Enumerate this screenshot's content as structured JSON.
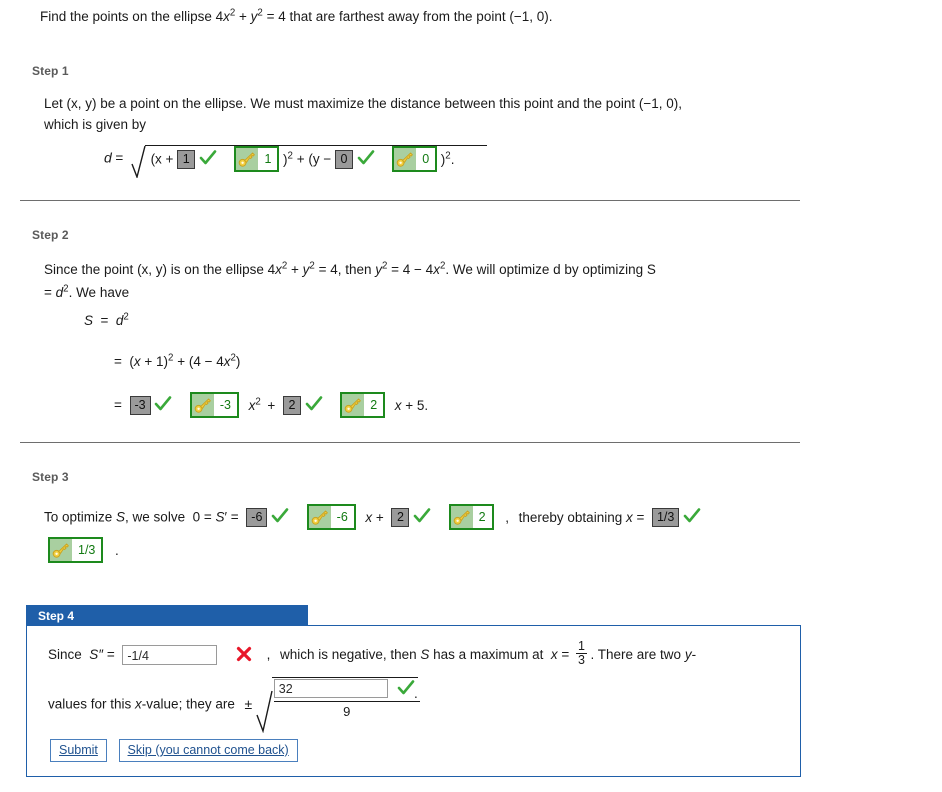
{
  "problem": {
    "prefix": "Find the points on the ellipse 4",
    "text_full": "Find the points on the ellipse 4x2 + y2 = 4 that are farthest away from the point (−1, 0).",
    "seg1": "Find the points on the ellipse 4",
    "var_x": "x",
    "exp2a": "2",
    "seg2": " + ",
    "var_y": "y",
    "exp2b": "2",
    "seg3": " = 4 that are farthest away from the point (−1, 0)."
  },
  "steps": [
    {
      "label": "Step 1",
      "line1": "Let (x, y) be a point on the ellipse. We must maximize the distance between this point and the point (−1, 0),",
      "line2": "which is given by",
      "formula": {
        "d_label": "d",
        "equals": "=",
        "open1": "(x + ",
        "answer1": "1",
        "key1": "1",
        "mid1": ")",
        "exp1": "2",
        "plus": " + (y − ",
        "answer2": "0",
        "key2": "0",
        "mid2": ")",
        "exp2": "2",
        "period": "."
      }
    },
    {
      "label": "Step 2",
      "line1_a": "Since the point (x, y) is on the ellipse  4",
      "line1_b": " = 4,  then  ",
      "line1_c": " = 4 − 4",
      "line1_d": ".  We will optimize d by optimizing S",
      "line2": "= d2. We have",
      "eq1": "S  =  d",
      "eq1_exp": "2",
      "eq2": "=  (x + 1)2 + (4 − 4x2)",
      "eq3": {
        "equals": "=",
        "answer1": "-3",
        "key1": "-3",
        "term1": "x",
        "term1_exp": "2",
        "plus": "+",
        "answer2": "2",
        "key2": "2",
        "term2": "x + 5."
      }
    },
    {
      "label": "Step 3",
      "line1": {
        "prefix": "To optimize S, we solve  0 = S′ =",
        "answer1": "-6",
        "key1": "-6",
        "mid": "x +",
        "answer2": "2",
        "key2": "2",
        "comma": ",",
        "suffix": "thereby obtaining x =",
        "answer3": "1/3"
      },
      "line2": {
        "key3": "1/3",
        "period": "."
      }
    },
    {
      "label": "Step 4",
      "line1": {
        "since": "Since",
        "symbol": "S″",
        "equals": "=",
        "input_value": "-1/4",
        "input_placeholder": "",
        "mark": "cross",
        "comma": ",",
        "mid": "which is negative, then S has a maximum at",
        "x_eq": "x =",
        "frac_num": "1",
        "frac_den": "3",
        "tail": ". There are two y-"
      },
      "line2": {
        "prefix": "values for this x-value; they are",
        "plusminus": "±",
        "rad_num_value": "32",
        "rad_den": "9",
        "mark": "check",
        "period": "."
      },
      "buttons": {
        "submit": "Submit",
        "skip": "Skip (you cannot come back)"
      }
    }
  ],
  "colors": {
    "header_blue": "#1f5fa9",
    "panel_border": "#1f5fa9",
    "check_green": "#3aa93a",
    "cross_red": "#e8182a",
    "key_border": "#1d8a1d",
    "key_slot": "#a9cfa0",
    "answer_gray": "#9a9a9a",
    "step_label": "#5a5a5a",
    "button_text": "#20528f"
  },
  "icons": {
    "check": "check-icon",
    "cross": "cross-icon",
    "key": "key-icon"
  }
}
